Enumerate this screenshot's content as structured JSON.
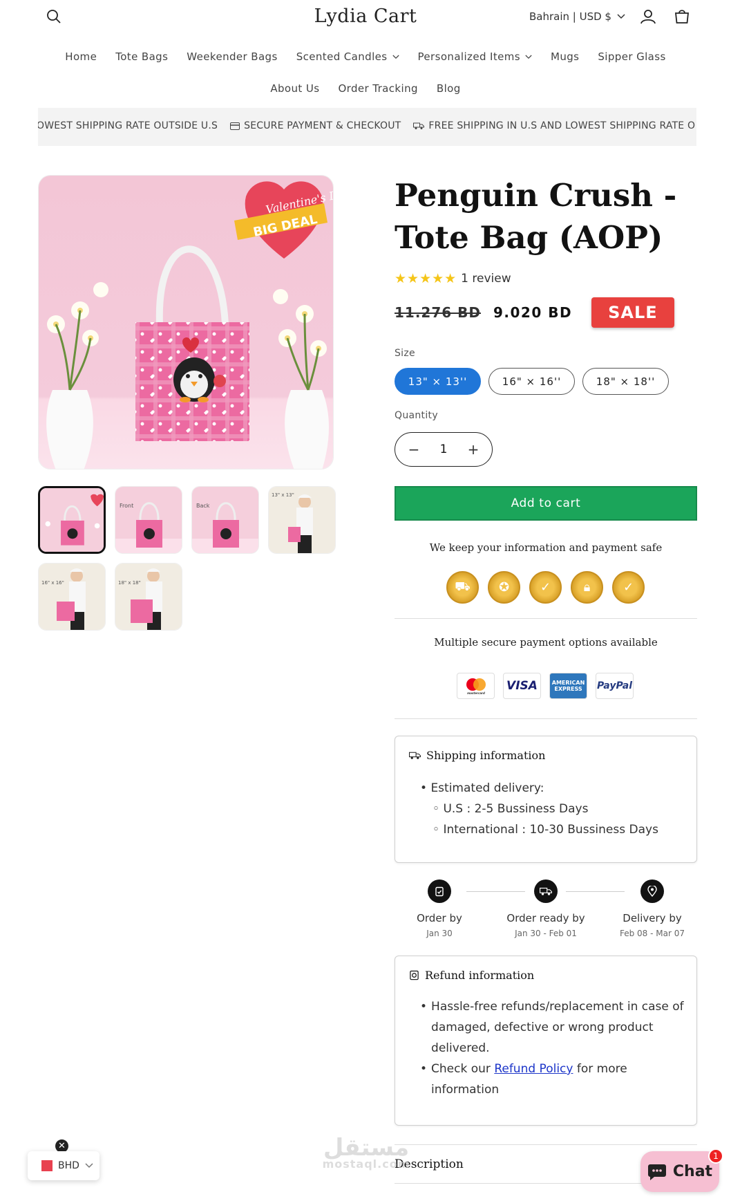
{
  "header": {
    "logo": "Lydia Cart",
    "locale": "Bahrain | USD $",
    "nav_row1": [
      "Home",
      "Tote Bags",
      "Weekender Bags",
      "Scented Candles",
      "Personalized Items",
      "Mugs",
      "Sipper Glass"
    ],
    "nav_row1_dropdown": [
      false,
      false,
      false,
      true,
      true,
      false,
      false
    ],
    "nav_row2": [
      "About Us",
      "Order Tracking",
      "Blog"
    ]
  },
  "announcement": {
    "items": [
      "OWEST SHIPPING RATE OUTSIDE U.S",
      "SECURE PAYMENT & CHECKOUT",
      "FREE SHIPPING IN U.S AND LOWEST SHIPPING RATE O"
    ]
  },
  "product": {
    "title": "Penguin Crush - Tote Bag (AOP)",
    "rating_stars": 5,
    "review_count": "1 review",
    "price_old": "11.276 BD",
    "price_new": "9.020 BD",
    "sale_badge": "SALE",
    "promo_heart_text": "Valentine's Day",
    "promo_ribbon_text": "BIG DEAL",
    "size_label": "Size",
    "sizes": [
      "13\" × 13''",
      "16\" × 16''",
      "18\" × 18''"
    ],
    "selected_size_index": 0,
    "quantity_label": "Quantity",
    "quantity": "1",
    "add_to_cart": "Add to cart",
    "thumbnail_labels": [
      "",
      "Front",
      "Back",
      "13\" x 13\"",
      "16\" x 16\"",
      "18\" x 18\""
    ]
  },
  "trust": {
    "safe_text": "We keep your information and payment safe",
    "badges": [
      "free-shipping-badge",
      "quality-badge",
      "guarantee-badge",
      "secure-badge",
      "satisfaction-badge"
    ],
    "payment_text": "Multiple secure payment options available",
    "payment_methods": [
      "mastercard",
      "VISA",
      "AMERICAN EXPRESS",
      "PayPal"
    ]
  },
  "shipping": {
    "heading": "Shipping information",
    "estimated": "Estimated delivery:",
    "us": "U.S : 2-5 Bussiness Days",
    "intl": "International : 10-30 Bussiness Days"
  },
  "timeline": [
    {
      "title": "Order by",
      "date": "Jan 30"
    },
    {
      "title": "Order ready by",
      "date": "Jan 30 - Feb 01"
    },
    {
      "title": "Delivery by",
      "date": "Feb 08 - Mar 07"
    }
  ],
  "refund": {
    "heading": "Refund information",
    "bullet1": "Hassle-free refunds/replacement in case of damaged, defective or wrong product delivered.",
    "bullet2_prefix": "Check our",
    "bullet2_link": "Refund Policy",
    "bullet2_suffix": "for more information"
  },
  "description_heading": "Description",
  "widgets": {
    "currency": "BHD",
    "chat_label": "Chat",
    "chat_count": "1",
    "watermark": "مستقل",
    "watermark_sub": "mostaql.com"
  },
  "colors": {
    "accent_blue": "#2076d8",
    "add_to_cart_green": "#1ba55a",
    "sale_red": "#e8413e",
    "star_yellow": "#f5c518"
  }
}
